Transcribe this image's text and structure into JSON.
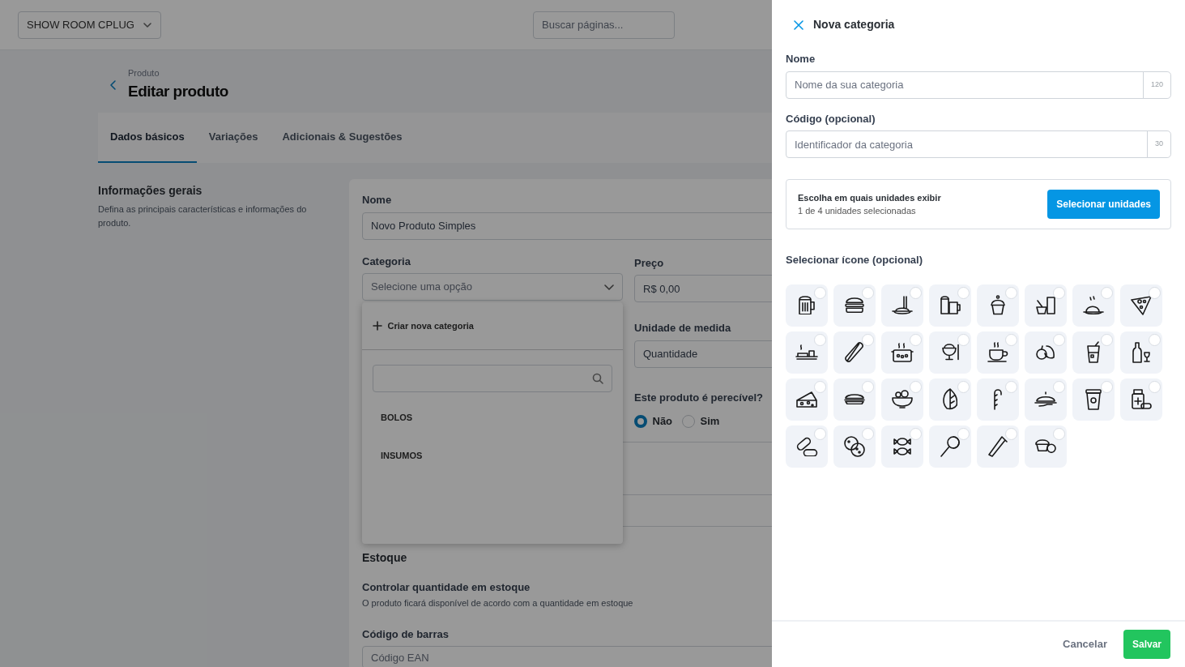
{
  "topbar": {
    "workspace": "SHOW ROOM CPLUG",
    "search": {
      "placeholder": "Buscar páginas..."
    }
  },
  "page": {
    "breadcrumb": "Produto",
    "title": "Editar produto"
  },
  "tabs": [
    {
      "label": "Dados básicos",
      "selected": true
    },
    {
      "label": "Variações",
      "selected": false
    },
    {
      "label": "Adicionais & Sugestões",
      "selected": false
    }
  ],
  "section": {
    "title": "Informações gerais",
    "description": "Defina as principais características e informações do produto."
  },
  "form": {
    "nome": {
      "label": "Nome",
      "value": "Novo Produto Simples"
    },
    "categoria": {
      "label": "Categoria",
      "placeholder": "Selecione uma opção",
      "dropdown": {
        "create_label": "Criar nova categoria",
        "options": [
          "BOLOS",
          "INSUMOS"
        ]
      }
    },
    "preco": {
      "label": "Preço",
      "value": "R$ 0,00"
    },
    "unidade": {
      "label": "Unidade de medida",
      "value": "Quantidade"
    },
    "perecivel": {
      "label": "Este produto é perecível?",
      "options": [
        {
          "label": "Não",
          "selected": true
        },
        {
          "label": "Sim",
          "selected": false
        }
      ]
    },
    "estoque": {
      "title": "Estoque",
      "control_label": "Controlar quantidade em estoque",
      "control_description": "O produto ficará disponível de acordo com a quantidade em estoque"
    },
    "barcode": {
      "label": "Código de barras",
      "placeholder": "Código EAN"
    }
  },
  "panel": {
    "title": "Nova categoria",
    "fields": [
      {
        "label": "Nome",
        "placeholder": "Nome da sua categoria",
        "counter": "120"
      },
      {
        "label": "Código (opcional)",
        "placeholder": "Identificador da categoria",
        "counter": "30"
      }
    ],
    "units": {
      "title": "Escolha em quais unidades exibir",
      "subtitle": "1 de 4 unidades selecionadas",
      "button": "Selecionar unidades"
    },
    "icon_label": "Selecionar ícone (opcional)",
    "icons": [
      {
        "selected": false
      },
      {
        "selected": false
      },
      {
        "selected": false
      },
      {
        "selected": false
      },
      {
        "selected": false
      },
      {
        "selected": false
      },
      {
        "selected": false
      },
      {
        "selected": false
      },
      {
        "selected": false
      },
      {
        "selected": false
      },
      {
        "selected": false
      },
      {
        "selected": false
      },
      {
        "selected": false
      },
      {
        "selected": false
      },
      {
        "selected": false
      },
      {
        "selected": false
      },
      {
        "selected": false
      },
      {
        "selected": false
      },
      {
        "selected": false
      },
      {
        "selected": false
      },
      {
        "selected": false
      },
      {
        "selected": false
      },
      {
        "selected": false
      },
      {
        "selected": false
      },
      {
        "selected": false
      },
      {
        "selected": false
      },
      {
        "selected": false
      },
      {
        "selected": false
      },
      {
        "selected": false
      },
      {
        "selected": false
      }
    ],
    "buttons": {
      "cancel": "Cancelar",
      "save": "Salvar"
    }
  }
}
